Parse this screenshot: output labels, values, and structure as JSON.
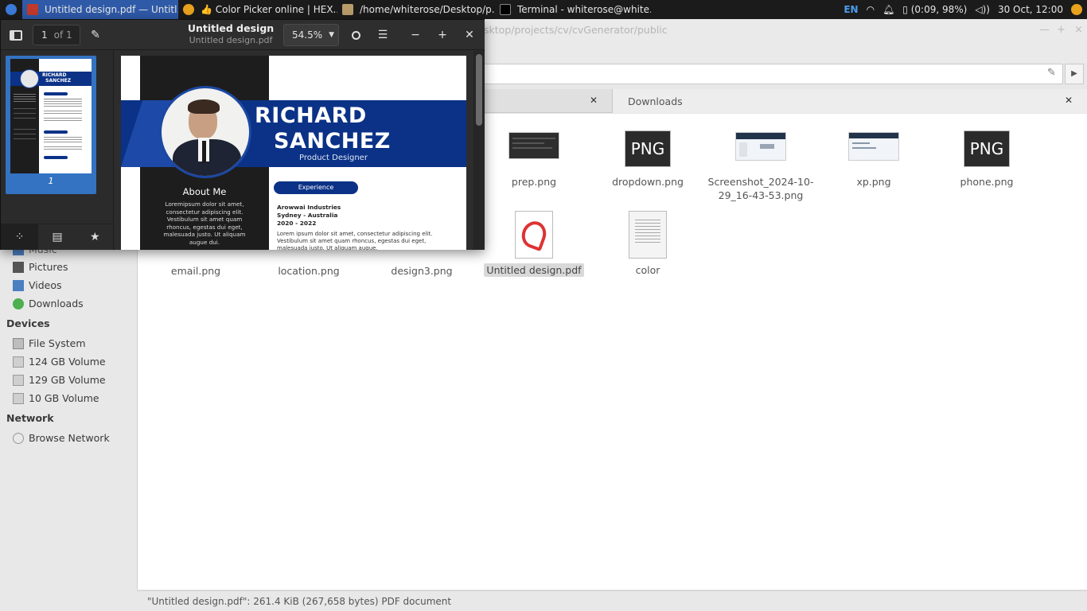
{
  "taskbar": {
    "tasks": [
      {
        "label": "Untitled design.pdf — Untitl...",
        "active": true
      },
      {
        "label": "👍 Color Picker online | HEX...",
        "active": false
      },
      {
        "label": "/home/whiterose/Desktop/p...",
        "active": false
      },
      {
        "label": "Terminal - whiterose@white...",
        "active": false
      }
    ],
    "language": "EN",
    "battery": "(0:09, 98%)",
    "datetime": "30 Oct, 12:00"
  },
  "file_manager": {
    "path_fragment": "sktop/projects/cv/cvGenerator/public",
    "tabs": [
      {
        "label": ""
      },
      {
        "label": "Downloads"
      }
    ],
    "sidebar": {
      "partial_item": "Music",
      "places": [
        "Pictures",
        "Videos",
        "Downloads"
      ],
      "devices_heading": "Devices",
      "devices": [
        "File System",
        "124 GB Volume",
        "129 GB Volume",
        "10 GB Volume"
      ],
      "network_heading": "Network",
      "network": [
        "Browse Network"
      ]
    },
    "files": [
      {
        "name": "prep.png"
      },
      {
        "name": "dropdown.png",
        "badge": "PNG"
      },
      {
        "name": "Screenshot_2024-10-29_16-43-53.png"
      },
      {
        "name": "xp.png"
      },
      {
        "name": "phone.png",
        "badge": "PNG"
      },
      {
        "name": "email.png"
      },
      {
        "name": "location.png"
      },
      {
        "name": "design3.png"
      },
      {
        "name": "Untitled design.pdf",
        "selected": true
      },
      {
        "name": "color"
      }
    ],
    "status": "\"Untitled design.pdf\": 261.4 KiB (267,658 bytes) PDF document"
  },
  "pdf_viewer": {
    "title": "Untitled design",
    "subtitle": "Untitled design.pdf",
    "page_current": "1",
    "page_total": "of 1",
    "zoom": "54.5%",
    "thumbnail_label": "1",
    "document": {
      "name_line1": "RICHARD",
      "name_line2": "SANCHEZ",
      "role": "Product Designer",
      "about_heading": "About Me",
      "about_text": "Loremipsum dolor sit amet, consectetur adipiscing elit. Vestibulum sit amet quam rhoncus, egestas dui eget, malesuada justo. Ut aliquam augue dui.",
      "experience_label": "Experience",
      "exp_company": "Arowwai Industries",
      "exp_location": "Sydney - Australia",
      "exp_years": "2020 - 2022",
      "exp_desc": "Lorem ipsum dolor sit amet, consectetur adipiscing elit. Vestibulum sit amet quam rhoncus, egestas dui eget, malesuada justo. Ut aliquam augue."
    }
  },
  "colors": {
    "taskbar_bg": "#1b1b1b",
    "taskbar_active": "#2f5aa8",
    "cv_blue": "#0b3287",
    "thumb_selected": "#3473c2"
  }
}
